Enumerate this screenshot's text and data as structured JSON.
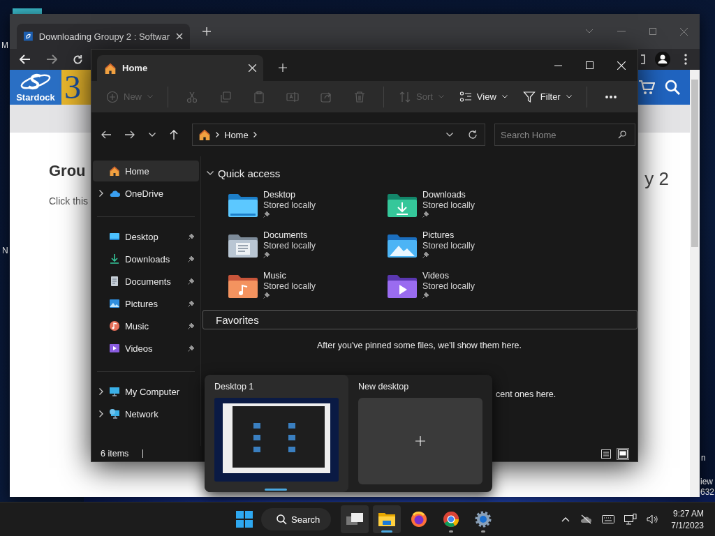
{
  "desktop": {
    "icon_labels": [
      "M",
      "N"
    ],
    "watermark_fragments": [
      "n",
      "iew",
      "632"
    ]
  },
  "browser": {
    "tabs": [
      {
        "title": "Downloading Groupy 2 : Softwar",
        "selected": true
      }
    ],
    "page": {
      "logo_text": "Stardock",
      "logo_badge": "3",
      "heading": "Grou",
      "heading_tail": "y 2",
      "body": "Click this"
    }
  },
  "explorer": {
    "tabs": [
      {
        "title": "Home",
        "selected": true
      }
    ],
    "toolbar": [
      {
        "kind": "new",
        "label": "New",
        "disabled": true
      },
      {
        "kind": "separator"
      },
      {
        "kind": "cut",
        "disabled": true
      },
      {
        "kind": "copy",
        "disabled": true
      },
      {
        "kind": "paste",
        "disabled": true
      },
      {
        "kind": "rename",
        "disabled": true
      },
      {
        "kind": "share",
        "disabled": true
      },
      {
        "kind": "delete",
        "disabled": true
      },
      {
        "kind": "separator"
      },
      {
        "kind": "sort",
        "label": "Sort",
        "disabled": true
      },
      {
        "kind": "view",
        "label": "View",
        "disabled": false
      },
      {
        "kind": "filter",
        "label": "Filter",
        "disabled": false
      },
      {
        "kind": "separator"
      },
      {
        "kind": "more",
        "disabled": false
      }
    ],
    "address": {
      "path": "Home"
    },
    "search": {
      "placeholder": "Search Home"
    },
    "sidebar": {
      "top": [
        {
          "label": "Home",
          "kind": "home",
          "expandable": false,
          "selected": true
        },
        {
          "label": "OneDrive",
          "kind": "cloud",
          "expandable": true,
          "selected": false
        }
      ],
      "pinned": [
        {
          "label": "Desktop",
          "kind": "desktop",
          "pinned": true,
          "selected": false
        },
        {
          "label": "Downloads",
          "kind": "downloads",
          "pinned": true,
          "selected": false
        },
        {
          "label": "Documents",
          "kind": "documents",
          "pinned": true,
          "selected": false
        },
        {
          "label": "Pictures",
          "kind": "pictures",
          "pinned": true,
          "selected": false
        },
        {
          "label": "Music",
          "kind": "music",
          "pinned": true,
          "selected": false
        },
        {
          "label": "Videos",
          "kind": "videos",
          "pinned": true,
          "selected": false
        }
      ],
      "bottom": [
        {
          "label": "My Computer",
          "kind": "computer",
          "expandable": true,
          "selected": false
        },
        {
          "label": "Network",
          "kind": "network",
          "expandable": true,
          "selected": false
        }
      ]
    },
    "quick_access": {
      "title": "Quick access",
      "expanded": true,
      "items": [
        {
          "name": "Desktop",
          "status": "Stored locally",
          "kind": "desktop",
          "pinned": true
        },
        {
          "name": "Downloads",
          "status": "Stored locally",
          "kind": "downloads",
          "pinned": true
        },
        {
          "name": "Documents",
          "status": "Stored locally",
          "kind": "documents",
          "pinned": true
        },
        {
          "name": "Pictures",
          "status": "Stored locally",
          "kind": "pictures",
          "pinned": true
        },
        {
          "name": "Music",
          "status": "Stored locally",
          "kind": "music",
          "pinned": true
        },
        {
          "name": "Videos",
          "status": "Stored locally",
          "kind": "videos",
          "pinned": true
        }
      ]
    },
    "favorites": {
      "title": "Favorites",
      "focused": true,
      "message": "After you've pinned some files, we'll show them here."
    },
    "recent": {
      "message": "cent ones here."
    },
    "status_bar": {
      "count": "6 items",
      "views": [
        {
          "kind": "details",
          "selected": false
        },
        {
          "kind": "tiles",
          "selected": true
        }
      ]
    }
  },
  "task_view": {
    "desktops": [
      {
        "name": "Desktop 1",
        "kind": "desktop",
        "selected": true
      },
      {
        "name": "New desktop",
        "kind": "new",
        "selected": false
      }
    ]
  },
  "taskbar": {
    "search_label": "Search",
    "apps": [
      {
        "kind": "task-view",
        "active": true,
        "running": false
      },
      {
        "kind": "explorer",
        "active": true,
        "running": true
      },
      {
        "kind": "firefox",
        "active": false,
        "running": false
      },
      {
        "kind": "chrome",
        "active": false,
        "running": true
      },
      {
        "kind": "settings",
        "active": false,
        "running": true
      }
    ],
    "clock": {
      "time": "9:27 AM",
      "date": "7/1/2023"
    }
  }
}
